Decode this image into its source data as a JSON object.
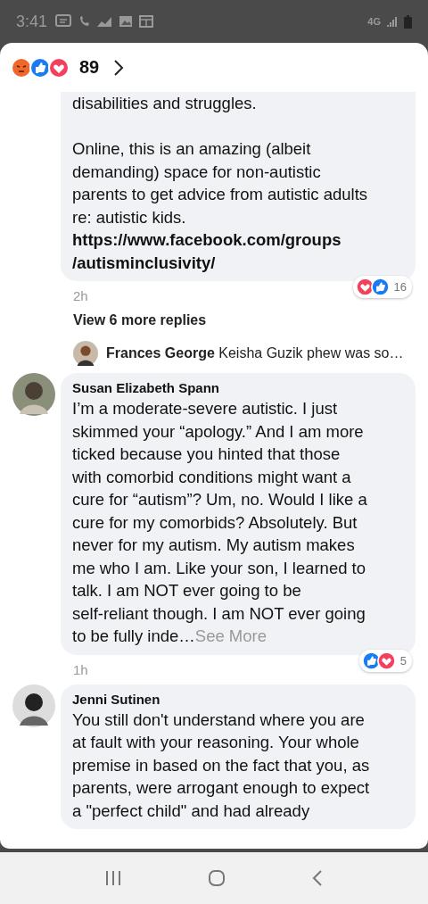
{
  "status_bar": {
    "time": "3:41",
    "network": "4G"
  },
  "header": {
    "reactions": [
      {
        "kind": "angry"
      },
      {
        "kind": "like"
      },
      {
        "kind": "love"
      }
    ],
    "count": "89"
  },
  "comments": [
    {
      "kind": "reply-top",
      "text": "disabilities and struggles.\n\nOnline, this is an amazing (albeit\ndemanding) space for non-autistic\nparents to get advice from autistic adults\nre: autistic kids.",
      "link": "https://www.facebook.com/groups\n/autisminclusivity/",
      "time": "2h",
      "reactions": [
        {
          "kind": "love"
        },
        {
          "kind": "like"
        }
      ],
      "reaction_count": "16"
    },
    {
      "kind": "more",
      "label": "View 6 more replies",
      "preview_name": "Frances George",
      "preview_text": "Keisha Guzik phew was so…"
    },
    {
      "kind": "comment",
      "name": "Susan Elizabeth Spann",
      "text": "I’m a moderate-severe autistic. I just\nskimmed your “apology.” And I am more\nticked because you hinted that those\nwith comorbid conditions might want a\ncure for “autism”? Um, no. Would I like a\ncure for my comorbids? Absolutely. But\nnever for my autism. My autism makes\nme who I am. Like your son, I learned to\ntalk. I am NOT ever going to be\nself-reliant though. I am NOT ever going\nto be fully inde…",
      "see_more": "See More",
      "time": "1h",
      "reactions": [
        {
          "kind": "like"
        },
        {
          "kind": "love"
        }
      ],
      "reaction_count": "5"
    },
    {
      "kind": "comment",
      "name": "Jenni Sutinen",
      "text": "You still don't understand where you are\nat fault with your reasoning. Your whole\npremise in based on the fact that you, as\nparents, were arrogant enough to expect\na \"perfect child\" and had already"
    }
  ]
}
